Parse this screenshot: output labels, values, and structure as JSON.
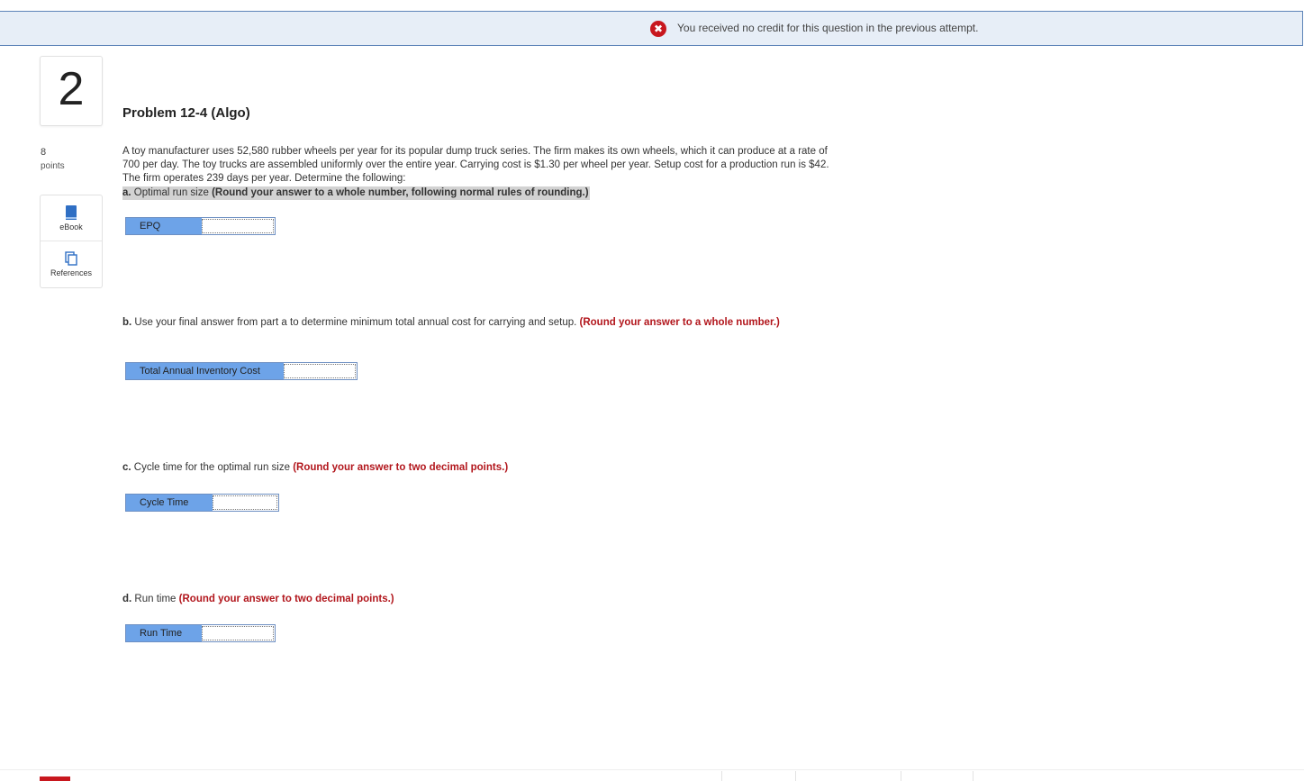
{
  "notice": {
    "icon": "error-x-icon",
    "icon_glyph": "✖",
    "text": "You received no credit for this question in the previous attempt."
  },
  "question": {
    "number": "2",
    "points_value": "8",
    "points_label": "points"
  },
  "resources": {
    "ebook_label": "eBook",
    "references_label": "References"
  },
  "problem": {
    "title": "Problem 12-4 (Algo)",
    "text": "A toy manufacturer uses 52,580 rubber wheels per year for its popular dump truck series. The firm makes its own wheels, which it can produce at a rate of 700 per day. The toy trucks are assembled uniformly over the entire year. Carrying cost is $1.30 per wheel per year. Setup cost for a production run is $42. The firm operates 239 days per year. Determine the following:"
  },
  "parts": {
    "a": {
      "lead": "a.",
      "text": " Optimal run size ",
      "instruction": "(Round your answer to a whole number, following normal rules of rounding.)",
      "answer_label": "EPQ",
      "answer_value": ""
    },
    "b": {
      "lead": "b.",
      "text": " Use your final answer from part a to determine minimum total annual cost for carrying and setup. ",
      "instruction": "(Round your answer to a whole number.)",
      "answer_label": "Total Annual Inventory Cost",
      "answer_value": ""
    },
    "c": {
      "lead": "c.",
      "text": " Cycle time for the optimal run size ",
      "instruction": "(Round your answer to two decimal points.)",
      "answer_label": "Cycle Time",
      "answer_value": ""
    },
    "d": {
      "lead": "d.",
      "text": " Run time ",
      "instruction": "(Round your answer to two decimal points.)",
      "answer_label": "Run Time",
      "answer_value": ""
    }
  },
  "colors": {
    "accent_red": "#c8171e",
    "instruction_red": "#b2161c",
    "answer_label_blue": "#6da3e8",
    "banner_bg": "#e7eef7"
  }
}
